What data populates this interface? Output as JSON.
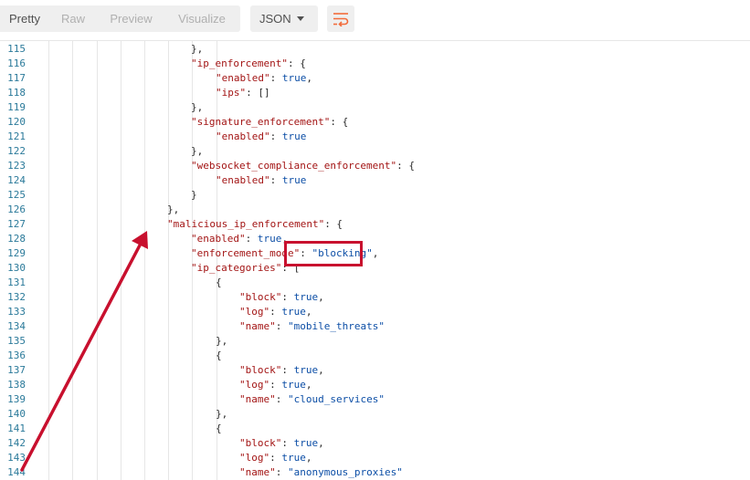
{
  "toolbar": {
    "tabs": [
      {
        "label": "Pretty",
        "active": true
      },
      {
        "label": "Raw",
        "active": false
      },
      {
        "label": "Preview",
        "active": false
      },
      {
        "label": "Visualize",
        "active": false
      }
    ],
    "format": "JSON",
    "wrap_icon": "wrap-lines-icon",
    "accent_color": "#f26b3a"
  },
  "editor": {
    "line_number_color": "#2b7a9a",
    "key_color": "#a31515",
    "value_color": "#0c4ea6",
    "annotation_color": "#c8102e",
    "lines": [
      {
        "n": "115",
        "indent": 7,
        "tokens": [
          {
            "t": "p",
            "v": "},"
          }
        ]
      },
      {
        "n": "116",
        "indent": 7,
        "tokens": [
          {
            "t": "k",
            "v": "\"ip_enforcement\""
          },
          {
            "t": "p",
            "v": ": {"
          }
        ]
      },
      {
        "n": "117",
        "indent": 8,
        "tokens": [
          {
            "t": "k",
            "v": "\"enabled\""
          },
          {
            "t": "p",
            "v": ": "
          },
          {
            "t": "b",
            "v": "true"
          },
          {
            "t": "p",
            "v": ","
          }
        ]
      },
      {
        "n": "118",
        "indent": 8,
        "tokens": [
          {
            "t": "k",
            "v": "\"ips\""
          },
          {
            "t": "p",
            "v": ": []"
          }
        ]
      },
      {
        "n": "119",
        "indent": 7,
        "tokens": [
          {
            "t": "p",
            "v": "},"
          }
        ]
      },
      {
        "n": "120",
        "indent": 7,
        "tokens": [
          {
            "t": "k",
            "v": "\"signature_enforcement\""
          },
          {
            "t": "p",
            "v": ": {"
          }
        ]
      },
      {
        "n": "121",
        "indent": 8,
        "tokens": [
          {
            "t": "k",
            "v": "\"enabled\""
          },
          {
            "t": "p",
            "v": ": "
          },
          {
            "t": "b",
            "v": "true"
          }
        ]
      },
      {
        "n": "122",
        "indent": 7,
        "tokens": [
          {
            "t": "p",
            "v": "},"
          }
        ]
      },
      {
        "n": "123",
        "indent": 7,
        "tokens": [
          {
            "t": "k",
            "v": "\"websocket_compliance_enforcement\""
          },
          {
            "t": "p",
            "v": ": {"
          }
        ]
      },
      {
        "n": "124",
        "indent": 8,
        "tokens": [
          {
            "t": "k",
            "v": "\"enabled\""
          },
          {
            "t": "p",
            "v": ": "
          },
          {
            "t": "b",
            "v": "true"
          }
        ]
      },
      {
        "n": "125",
        "indent": 7,
        "tokens": [
          {
            "t": "p",
            "v": "}"
          }
        ]
      },
      {
        "n": "126",
        "indent": 6,
        "tokens": [
          {
            "t": "p",
            "v": "},"
          }
        ]
      },
      {
        "n": "127",
        "indent": 6,
        "tokens": [
          {
            "t": "k",
            "v": "\"malicious_ip_enforcement\""
          },
          {
            "t": "p",
            "v": ": {"
          }
        ]
      },
      {
        "n": "128",
        "indent": 7,
        "tokens": [
          {
            "t": "k",
            "v": "\"enabled\""
          },
          {
            "t": "p",
            "v": ": "
          },
          {
            "t": "b",
            "v": "true"
          },
          {
            "t": "p",
            "v": ","
          }
        ]
      },
      {
        "n": "129",
        "indent": 7,
        "tokens": [
          {
            "t": "k",
            "v": "\"enforcement_mode\""
          },
          {
            "t": "p",
            "v": ": "
          },
          {
            "t": "s",
            "v": "\"blocking\""
          },
          {
            "t": "p",
            "v": ","
          }
        ]
      },
      {
        "n": "130",
        "indent": 7,
        "tokens": [
          {
            "t": "k",
            "v": "\"ip_categories\""
          },
          {
            "t": "p",
            "v": ": ["
          }
        ]
      },
      {
        "n": "131",
        "indent": 8,
        "tokens": [
          {
            "t": "p",
            "v": "{"
          }
        ]
      },
      {
        "n": "132",
        "indent": 9,
        "tokens": [
          {
            "t": "k",
            "v": "\"block\""
          },
          {
            "t": "p",
            "v": ": "
          },
          {
            "t": "b",
            "v": "true"
          },
          {
            "t": "p",
            "v": ","
          }
        ]
      },
      {
        "n": "133",
        "indent": 9,
        "tokens": [
          {
            "t": "k",
            "v": "\"log\""
          },
          {
            "t": "p",
            "v": ": "
          },
          {
            "t": "b",
            "v": "true"
          },
          {
            "t": "p",
            "v": ","
          }
        ]
      },
      {
        "n": "134",
        "indent": 9,
        "tokens": [
          {
            "t": "k",
            "v": "\"name\""
          },
          {
            "t": "p",
            "v": ": "
          },
          {
            "t": "s",
            "v": "\"mobile_threats\""
          }
        ]
      },
      {
        "n": "135",
        "indent": 8,
        "tokens": [
          {
            "t": "p",
            "v": "},"
          }
        ]
      },
      {
        "n": "136",
        "indent": 8,
        "tokens": [
          {
            "t": "p",
            "v": "{"
          }
        ]
      },
      {
        "n": "137",
        "indent": 9,
        "tokens": [
          {
            "t": "k",
            "v": "\"block\""
          },
          {
            "t": "p",
            "v": ": "
          },
          {
            "t": "b",
            "v": "true"
          },
          {
            "t": "p",
            "v": ","
          }
        ]
      },
      {
        "n": "138",
        "indent": 9,
        "tokens": [
          {
            "t": "k",
            "v": "\"log\""
          },
          {
            "t": "p",
            "v": ": "
          },
          {
            "t": "b",
            "v": "true"
          },
          {
            "t": "p",
            "v": ","
          }
        ]
      },
      {
        "n": "139",
        "indent": 9,
        "tokens": [
          {
            "t": "k",
            "v": "\"name\""
          },
          {
            "t": "p",
            "v": ": "
          },
          {
            "t": "s",
            "v": "\"cloud_services\""
          }
        ]
      },
      {
        "n": "140",
        "indent": 8,
        "tokens": [
          {
            "t": "p",
            "v": "},"
          }
        ]
      },
      {
        "n": "141",
        "indent": 8,
        "tokens": [
          {
            "t": "p",
            "v": "{"
          }
        ]
      },
      {
        "n": "142",
        "indent": 9,
        "tokens": [
          {
            "t": "k",
            "v": "\"block\""
          },
          {
            "t": "p",
            "v": ": "
          },
          {
            "t": "b",
            "v": "true"
          },
          {
            "t": "p",
            "v": ","
          }
        ]
      },
      {
        "n": "143",
        "indent": 9,
        "tokens": [
          {
            "t": "k",
            "v": "\"log\""
          },
          {
            "t": "p",
            "v": ": "
          },
          {
            "t": "b",
            "v": "true"
          },
          {
            "t": "p",
            "v": ","
          }
        ]
      },
      {
        "n": "144",
        "indent": 9,
        "tokens": [
          {
            "t": "k",
            "v": "\"name\""
          },
          {
            "t": "p",
            "v": ": "
          },
          {
            "t": "s",
            "v": "\"anonymous_proxies\""
          }
        ]
      }
    ]
  }
}
